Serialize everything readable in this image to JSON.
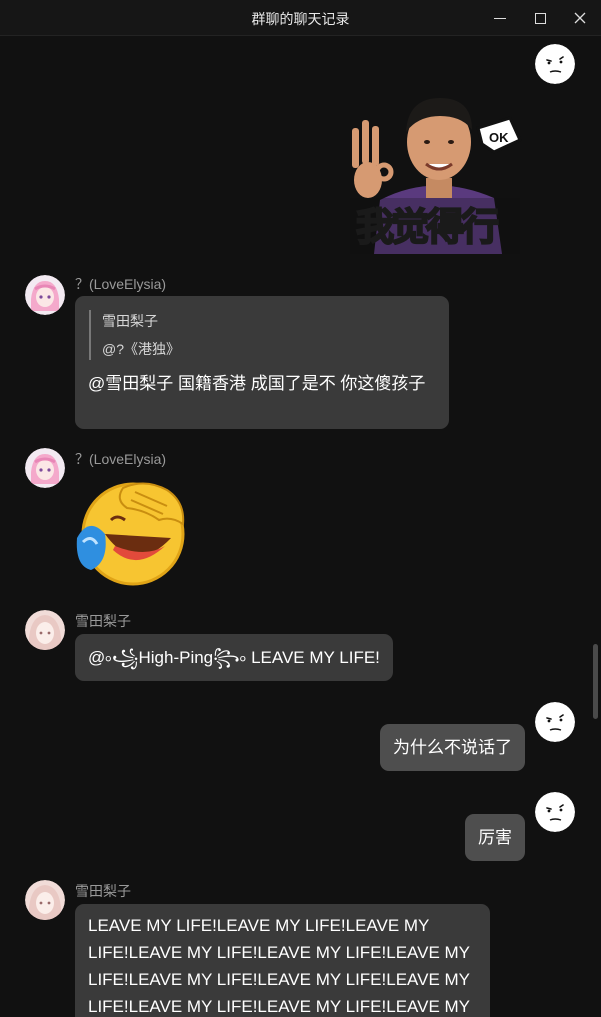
{
  "window": {
    "title": "群聊的聊天记录",
    "controls": [
      "minimize",
      "maximize",
      "close"
    ]
  },
  "messages": [
    {
      "direction": "outgoing",
      "type": "sticker",
      "sticker_text": "我觉得行",
      "sticker_badge": "OK"
    },
    {
      "direction": "incoming",
      "sender": "？(LoveElysia)",
      "type": "reply",
      "quote_name": "雪田梨子",
      "quote_text": "@?《港独》",
      "text": "@雪田梨子 国籍香港 成国了是不 你这傻孩子"
    },
    {
      "direction": "incoming",
      "sender": "？(LoveElysia)",
      "type": "sticker",
      "sticker_desc": "laughing-crying-emoji"
    },
    {
      "direction": "incoming",
      "sender": "雪田梨子",
      "type": "text",
      "text": "@৹꧁High-Ping꧂৹  LEAVE MY LIFE!"
    },
    {
      "direction": "outgoing",
      "type": "text",
      "text": "为什么不说话了"
    },
    {
      "direction": "outgoing",
      "type": "text",
      "text": "厉害"
    },
    {
      "direction": "incoming",
      "sender": "雪田梨子",
      "type": "text",
      "lines": [
        "LEAVE MY LIFE!LEAVE MY LIFE!LEAVE MY",
        "LIFE!LEAVE MY LIFE!LEAVE MY LIFE!LEAVE MY",
        "LIFE!LEAVE MY LIFE!LEAVE MY LIFE!LEAVE MY",
        "LIFE!LEAVE MY LIFE!LEAVE MY LIFE!LEAVE MY"
      ]
    }
  ],
  "colors": {
    "background": "#111111",
    "incoming_bubble": "#3a3a3a",
    "outgoing_bubble": "#4e4e4e",
    "sender_name": "#9a9a9a"
  }
}
